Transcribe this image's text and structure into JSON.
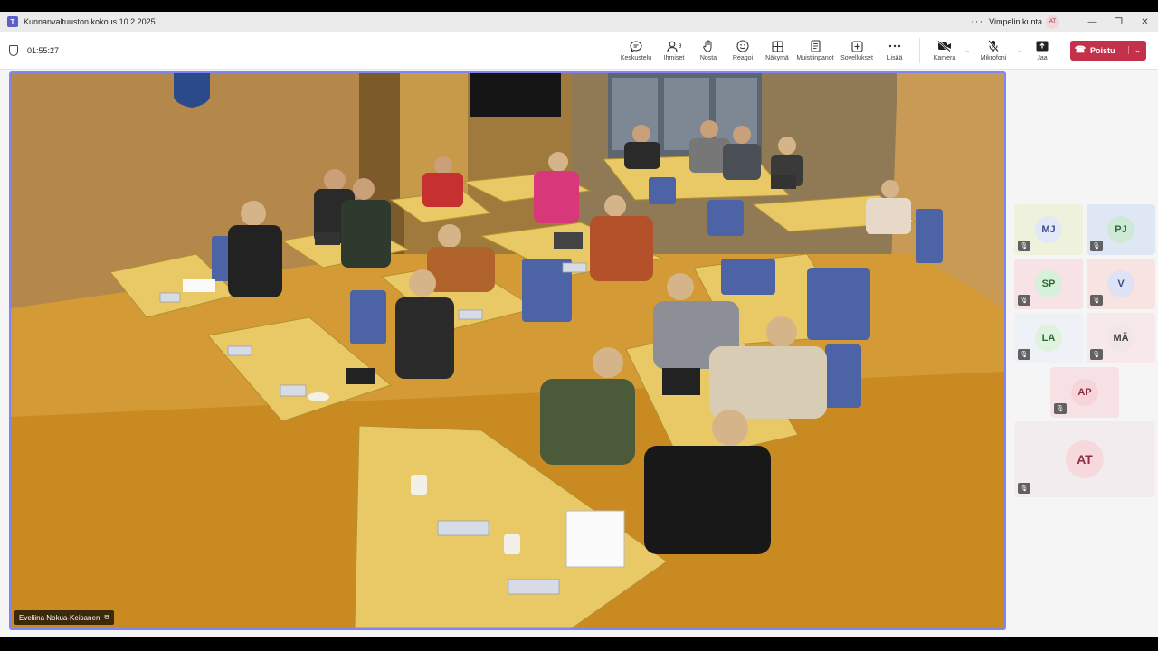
{
  "window": {
    "title": "Kunnanvaltuuston kokous 10.2.2025",
    "more_glyph": "···",
    "org_name": "Vimpelin kunta",
    "org_avatar": "AT",
    "minimize": "—",
    "maximize": "❐",
    "close": "✕"
  },
  "meeting": {
    "timer": "01:55:27"
  },
  "toolbar": {
    "chat": "Keskustelu",
    "people": "Ihmiset",
    "people_count": "9",
    "raise": "Nosta",
    "react": "Reagoi",
    "view": "Näkymä",
    "notes": "Muistiinpanot",
    "apps": "Sovellukset",
    "more": "Lisää",
    "camera": "Kamera",
    "mic": "Mikrofoni",
    "share": "Jaa",
    "leave": "Poistu"
  },
  "stage": {
    "speaker_name": "Eveliina Nokua-Keisanen"
  },
  "participants": [
    {
      "initials": "MJ",
      "bg": "#eef1dc",
      "avatar_bg": "#e2e8f5",
      "color": "#3b4e8c"
    },
    {
      "initials": "PJ",
      "bg": "#dfe7f5",
      "avatar_bg": "#cfe9d7",
      "color": "#2e6b43"
    },
    {
      "initials": "SP",
      "bg": "#f7e2e6",
      "avatar_bg": "#d6f0d9",
      "color": "#2d6a38"
    },
    {
      "initials": "V",
      "bg": "#f7e4e2",
      "avatar_bg": "#dde3f4",
      "color": "#3a4a86"
    },
    {
      "initials": "LA",
      "bg": "#eef1f5",
      "avatar_bg": "#dff2df",
      "color": "#2d6a38"
    },
    {
      "initials": "MÄ",
      "bg": "#f7e8ea",
      "avatar_bg": "#f3e6e6",
      "color": "#444"
    },
    {
      "initials": "AP",
      "bg": "#f6e1e4",
      "avatar_bg": "#f5d5da",
      "color": "#8c2f3e"
    },
    {
      "initials": "AT",
      "bg": "#f3ecee",
      "avatar_bg": "#f7d9dd",
      "color": "#8c2f3e"
    }
  ],
  "colors": {
    "leave": "#c4314b",
    "stage_border": "#7f85f5",
    "brand": "#5b5fc7"
  }
}
